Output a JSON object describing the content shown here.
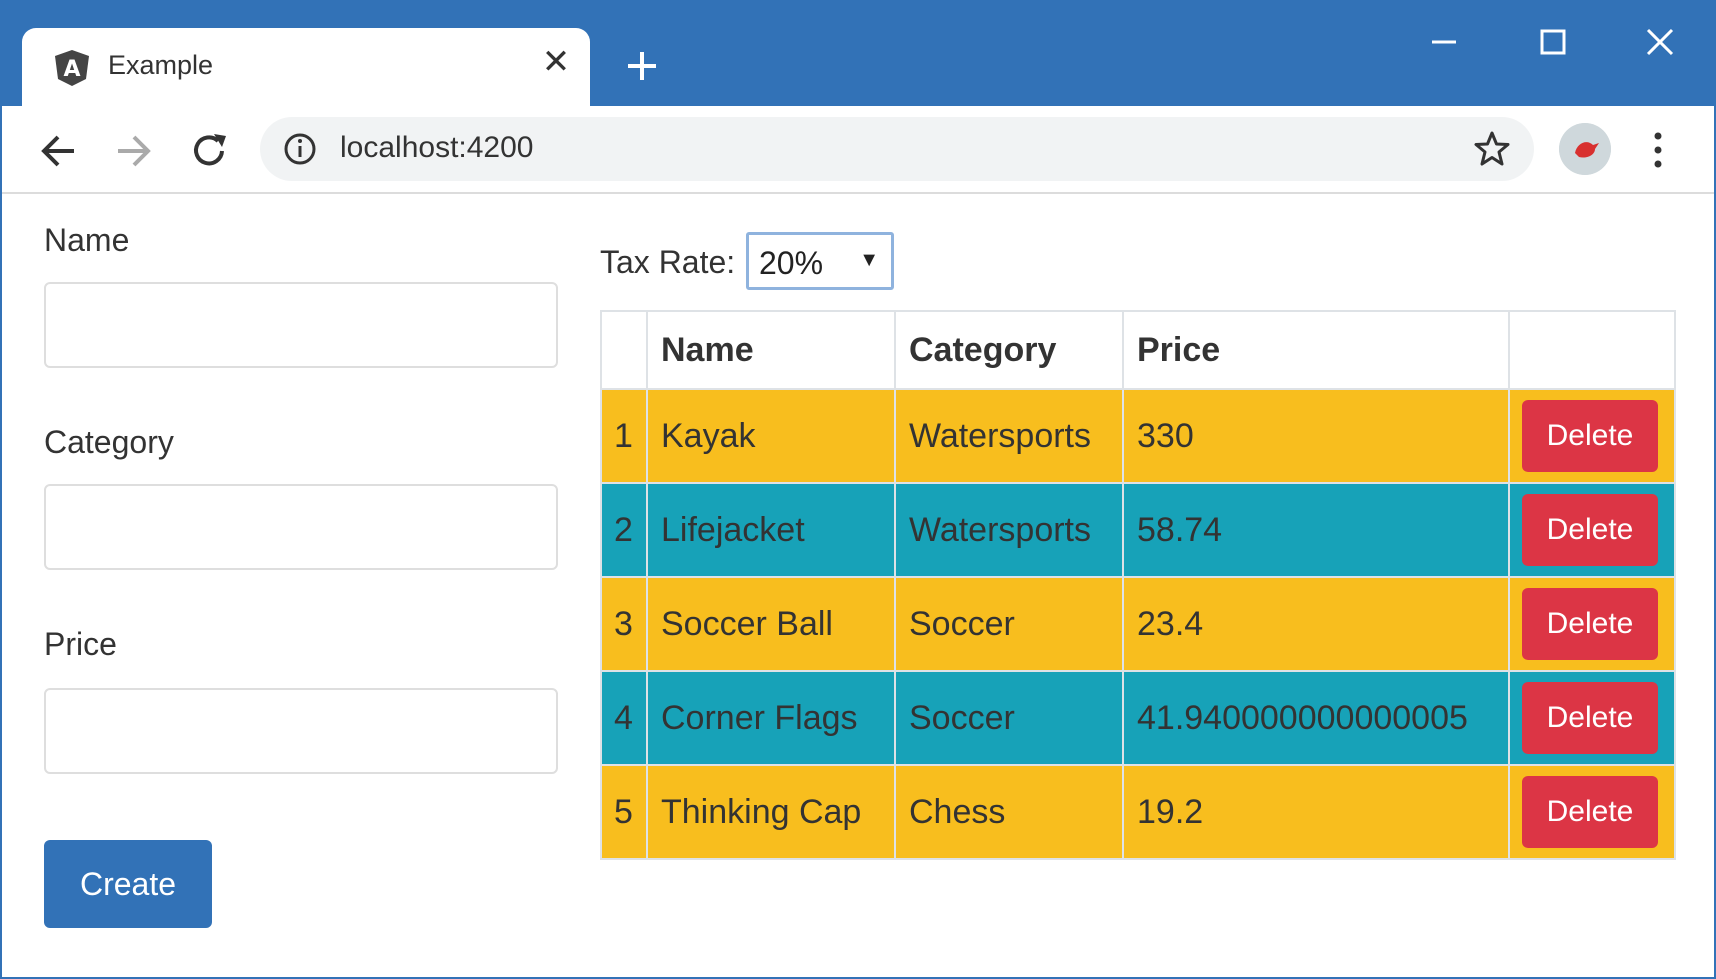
{
  "browser": {
    "tab_title": "Example",
    "url": "localhost:4200"
  },
  "form": {
    "name_label": "Name",
    "category_label": "Category",
    "price_label": "Price",
    "name_value": "",
    "category_value": "",
    "price_value": "",
    "create_label": "Create"
  },
  "tax": {
    "label": "Tax Rate:",
    "selected": "20%"
  },
  "table": {
    "headers": [
      "",
      "Name",
      "Category",
      "Price",
      ""
    ],
    "rows": [
      {
        "index": "1",
        "name": "Kayak",
        "category": "Watersports",
        "price": "330",
        "action": "Delete"
      },
      {
        "index": "2",
        "name": "Lifejacket",
        "category": "Watersports",
        "price": "58.74",
        "action": "Delete"
      },
      {
        "index": "3",
        "name": "Soccer Ball",
        "category": "Soccer",
        "price": "23.4",
        "action": "Delete"
      },
      {
        "index": "4",
        "name": "Corner Flags",
        "category": "Soccer",
        "price": "41.940000000000005",
        "action": "Delete"
      },
      {
        "index": "5",
        "name": "Thinking Cap",
        "category": "Chess",
        "price": "19.2",
        "action": "Delete"
      }
    ]
  },
  "colors": {
    "chrome_blue": "#3272b7",
    "row_warning": "#f8be1e",
    "row_info": "#17a2b8",
    "danger": "#dc3545"
  },
  "icons": [
    "angular-logo-icon",
    "close-icon",
    "plus-icon",
    "minimize-icon",
    "maximize-icon",
    "back-arrow-icon",
    "forward-arrow-icon",
    "reload-icon",
    "info-icon",
    "star-icon",
    "avatar-bird-icon",
    "more-vert-icon",
    "dropdown-arrow-icon"
  ]
}
